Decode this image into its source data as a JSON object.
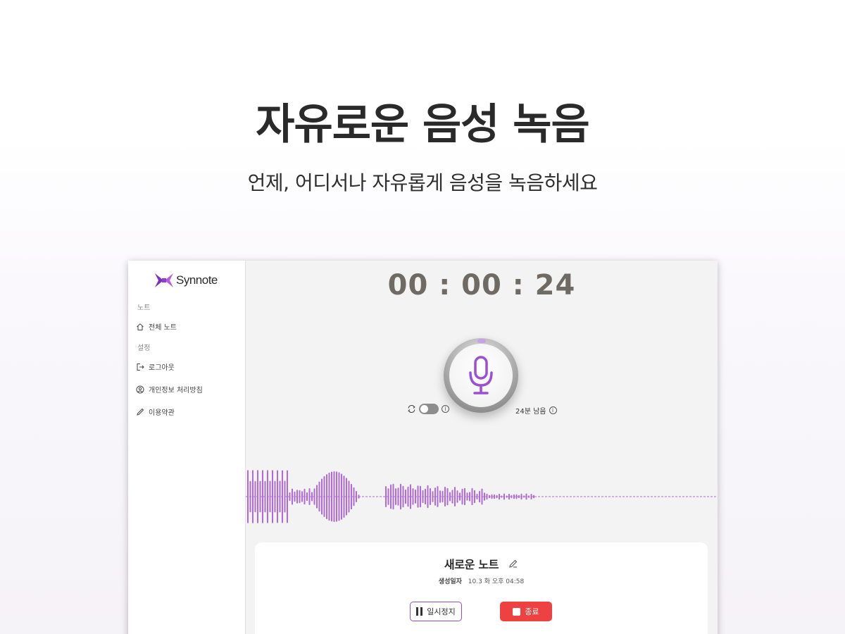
{
  "hero": {
    "title": "자유로운 음성 녹음",
    "subtitle": "언제, 어디서나 자유롭게 음성을 녹음하세요"
  },
  "sidebar": {
    "logo_text": "Synnote",
    "sections": [
      {
        "label": "노트",
        "items": [
          {
            "label": "전체 노트",
            "icon": "home-icon"
          }
        ]
      },
      {
        "label": "설정",
        "items": [
          {
            "label": "로그아웃",
            "icon": "logout-icon"
          },
          {
            "label": "개인정보 처리방침",
            "icon": "user-circle-icon"
          },
          {
            "label": "이용약관",
            "icon": "pencil-icon"
          }
        ]
      }
    ]
  },
  "recorder": {
    "timer": "00 : 00 : 24",
    "remaining": "24분 남음",
    "mic_icon": "microphone-icon",
    "auto_toggle_on": false
  },
  "note": {
    "title": "새로운 노트",
    "meta_label": "생성일자",
    "meta_value": "10.3 화 오후 04:58",
    "pause_label": "일시정지",
    "stop_label": "종료"
  },
  "colors": {
    "accent": "#9b4fd6",
    "wave": "#b06ad9",
    "stop": "#ee4242",
    "timer": "#6f6a64"
  }
}
